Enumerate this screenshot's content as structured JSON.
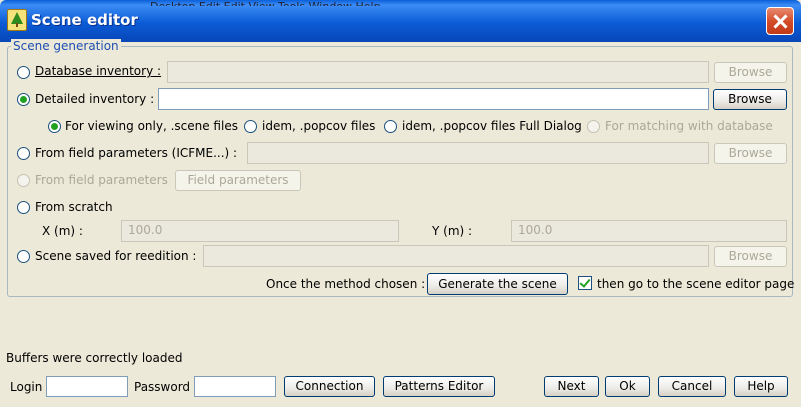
{
  "window": {
    "title": "Scene editor",
    "background_menu": "Desktop   Edit   Edit   View   Tools   Window   Help"
  },
  "group": {
    "title": "Scene generation"
  },
  "options": {
    "database_inventory": {
      "label": "Database inventory :",
      "value": "",
      "browse": "Browse"
    },
    "detailed_inventory": {
      "label": "Detailed inventory :",
      "value": "",
      "browse": "Browse"
    },
    "sub_options": [
      {
        "label": "For viewing only, .scene files"
      },
      {
        "label": "idem, .popcov files"
      },
      {
        "label": "idem, .popcov files Full Dialog"
      },
      {
        "label": "For matching with database"
      }
    ],
    "field_params_icfme": {
      "label": "From field parameters (ICFME...) :",
      "value": "",
      "browse": "Browse"
    },
    "field_params": {
      "label": "From field parameters",
      "button": "Field parameters"
    },
    "from_scratch": {
      "label": "From scratch",
      "x_label": "X (m) :",
      "x_value": "100.0",
      "y_label": "Y (m) :",
      "y_value": "100.0"
    },
    "scene_saved": {
      "label": "Scene saved for reedition :",
      "value": "",
      "browse": "Browse"
    }
  },
  "generate": {
    "prompt": "Once the method chosen :",
    "button": "Generate the scene",
    "checkbox_label": "then go to the scene editor page",
    "checked": true
  },
  "status": "Buffers were correctly loaded",
  "footer": {
    "login_label": "Login",
    "login_value": "",
    "password_label": "Password",
    "password_value": "",
    "connection": "Connection",
    "patterns_editor": "Patterns Editor",
    "next": "Next",
    "ok": "Ok",
    "cancel": "Cancel",
    "help": "Help"
  },
  "colors": {
    "title_bar": "#0a5fd8",
    "close_button": "#d24a26",
    "group_title": "#1f4fb3",
    "radio_selected": "#21a121",
    "window_bg": "#ece9d8"
  },
  "icons": [
    "tree-app-icon",
    "close-icon",
    "check-icon"
  ]
}
